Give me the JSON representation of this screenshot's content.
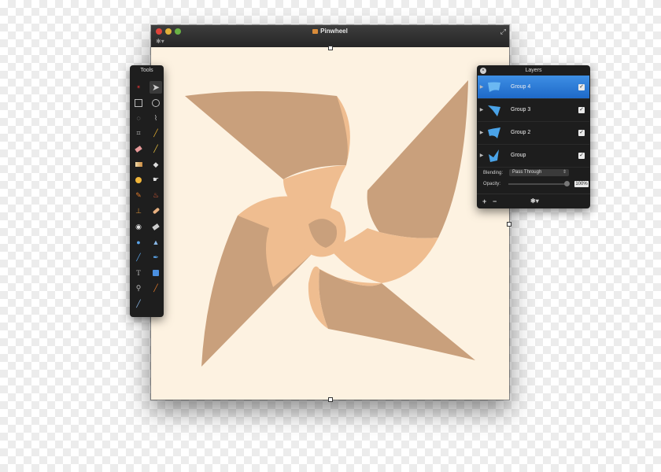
{
  "window": {
    "title": "Pinwheel"
  },
  "tools_panel": {
    "title": "Tools",
    "tools": [
      [
        "select-brush-icon",
        "arrow-pointer-icon"
      ],
      [
        "rect-select-icon",
        "ellipse-select-icon"
      ],
      [
        "lasso-icon",
        "magic-wand-icon"
      ],
      [
        "crop-icon",
        "eyedropper-icon"
      ],
      [
        "eraser-icon",
        "pencil-icon"
      ],
      [
        "gradient-icon",
        "paint-bucket-icon"
      ],
      [
        "sponge-icon",
        "smudge-icon"
      ],
      [
        "brush-icon",
        "burn-icon"
      ],
      [
        "clone-stamp-icon",
        "healing-icon"
      ],
      [
        "red-eye-icon",
        "patch-icon"
      ],
      [
        "blur-drop-icon",
        "sharpen-icon"
      ],
      [
        "pen-icon",
        "freeform-pen-icon"
      ],
      [
        "text-icon",
        "shape-icon"
      ],
      [
        "zoom-icon",
        "color-picker-icon"
      ],
      [
        "line-icon",
        ""
      ]
    ]
  },
  "layers_panel": {
    "title": "Layers",
    "layers": [
      {
        "name": "Group 4",
        "checked": "✓"
      },
      {
        "name": "Group 3",
        "checked": "✓"
      },
      {
        "name": "Group 2",
        "checked": "✓"
      },
      {
        "name": "Group",
        "checked": "✓"
      }
    ],
    "blending_label": "Blending:",
    "blending_value": "Pass Through",
    "opacity_label": "Opacity:",
    "opacity_value": "100%",
    "add_label": "+",
    "remove_label": "−"
  },
  "colors": {
    "canvas": "#fdf2e1",
    "blade_dark": "#c9a07c",
    "blade_light": "#efbd90",
    "layer_active": "#2f7fd8",
    "layer_thumb": "#4aa3e8"
  }
}
